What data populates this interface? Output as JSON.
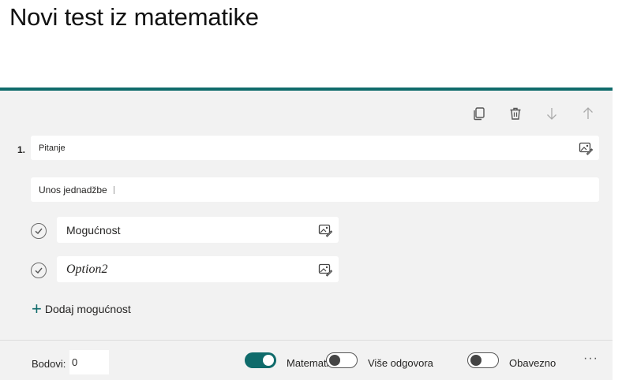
{
  "form": {
    "title": "Novi test iz matematike"
  },
  "question": {
    "number": "1.",
    "text": "Pitanje",
    "equation_placeholder": "Unos jednadžbe",
    "options": [
      {
        "label": "Mogućnost",
        "style": "normal"
      },
      {
        "label": "Option2",
        "style": "math-italic"
      }
    ],
    "add_option_label": "Dodaj mogućnost"
  },
  "toolbar": {
    "icons": [
      "copy-icon",
      "trash-icon",
      "arrow-down-icon",
      "arrow-up-icon"
    ]
  },
  "footer": {
    "points_label": "Bodovi:",
    "points_value": "0",
    "math_label": "Matematika",
    "math_on": true,
    "multiple_label": "Više odgovora",
    "multiple_on": false,
    "required_label": "Obavezno",
    "required_on": false,
    "more_label": "···"
  },
  "colors": {
    "accent": "#0f6b6b",
    "card_bg": "#f2f2f2"
  }
}
